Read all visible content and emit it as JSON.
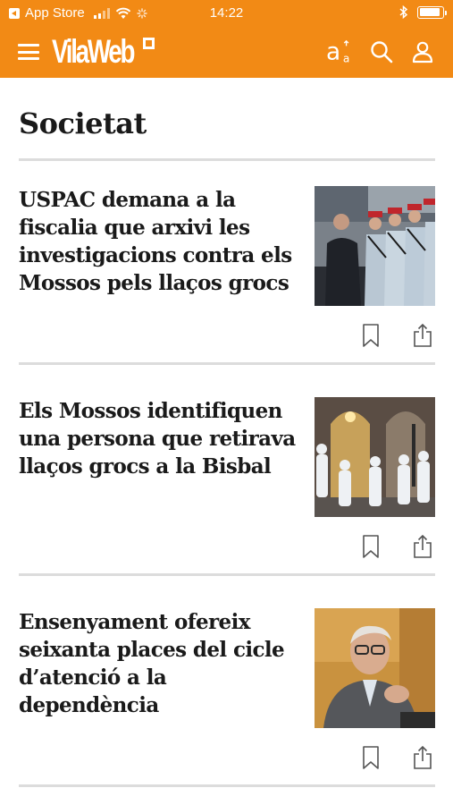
{
  "status_bar": {
    "back_app": "App Store",
    "time": "14:22",
    "battery_level": 0.9
  },
  "app_bar": {
    "logo": "VilaWeb",
    "icons": [
      "menu-icon",
      "font-size-icon",
      "search-icon",
      "user-icon"
    ]
  },
  "section": {
    "title": "Societat"
  },
  "articles": [
    {
      "headline": "USPAC demana a la fiscalia que arxivi les investigacions contra els Mossos pels llaços grocs",
      "image": "photo-politician-greeting-mossos-officers"
    },
    {
      "headline": "Els Mossos identifiquen una persona que retirava llaços grocs a la Bisbal",
      "image": "photo-white-suited-people-under-arcades"
    },
    {
      "headline": "Ensenyament ofereix seixanta places del cicle d’atenció a la dependència",
      "image": "photo-man-with-glasses-portrait"
    }
  ],
  "colors": {
    "brand_orange": "#f28a15",
    "text": "#1a1a1a",
    "divider": "#dcdcdc",
    "icon_gray": "#555555"
  }
}
